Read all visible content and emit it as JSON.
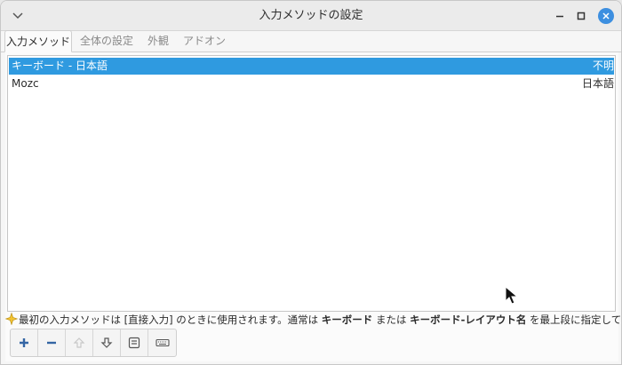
{
  "window": {
    "title": "入力メソッドの設定"
  },
  "tabs": [
    {
      "label": "入力メソッド",
      "active": true
    },
    {
      "label": "全体の設定",
      "active": false
    },
    {
      "label": "外観",
      "active": false
    },
    {
      "label": "アドオン",
      "active": false
    }
  ],
  "input_methods": [
    {
      "name": "キーボード - 日本語",
      "language": "不明",
      "selected": true
    },
    {
      "name": "Mozc",
      "language": "日本語",
      "selected": false
    }
  ],
  "hint": {
    "part1": "最初の入力メソッドは [直接入力] のときに使用されます。通常は ",
    "bold1": "キーボード",
    "part2": " または ",
    "bold2": "キーボード-レイアウト名",
    "part3": " を最上段に指定してください。"
  },
  "toolbar": {
    "buttons": [
      {
        "icon": "add-icon",
        "enabled": true
      },
      {
        "icon": "remove-icon",
        "enabled": true
      },
      {
        "icon": "move-up-icon",
        "enabled": false
      },
      {
        "icon": "move-down-icon",
        "enabled": true
      },
      {
        "icon": "configure-icon",
        "enabled": true
      },
      {
        "icon": "keyboard-layout-icon",
        "enabled": true
      }
    ]
  },
  "colors": {
    "selection": "#2f9ae0",
    "close_button": "#3d8fe0",
    "icon_blue": "#3465a4"
  }
}
